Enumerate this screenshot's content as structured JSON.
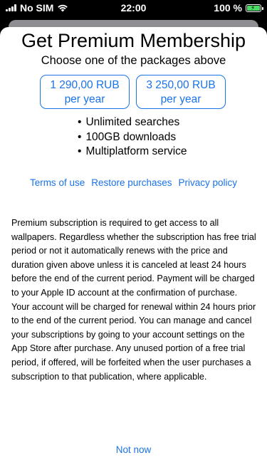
{
  "status_bar": {
    "carrier": "No SIM",
    "time": "22:00",
    "battery_percent": "100 %",
    "battery_color": "#4cd964"
  },
  "sheet": {
    "title": "Get Premium Membership",
    "subtitle": "Choose one of the packages above",
    "packages": [
      {
        "price": "1 290,00 RUB",
        "period": "per year"
      },
      {
        "price": "3 250,00 RUB",
        "period": "per year"
      }
    ],
    "features": [
      "Unlimited searches",
      "100GB downloads",
      "Multiplatform service"
    ],
    "links": {
      "terms": "Terms of use",
      "restore": "Restore purchases",
      "privacy": "Privacy policy"
    },
    "legal_text": "Premium subscription is required to get access to all wallpapers. Regardless whether the subscription has free trial period or not it automatically renews with the price and duration given above unless it is canceled at least 24 hours before the end of the current period. Payment will be charged to your Apple ID account at the confirmation of purchase. Your account will be charged for renewal within 24 hours prior to the end of the current period. You can manage and cancel your subscriptions by going to your account settings on the App Store after purchase. Any unused portion of a free trial period, if offered, will be forfeited when the user purchases a subscription to that publication, where applicable.",
    "not_now": "Not now",
    "accent_color": "#1a73e8"
  }
}
